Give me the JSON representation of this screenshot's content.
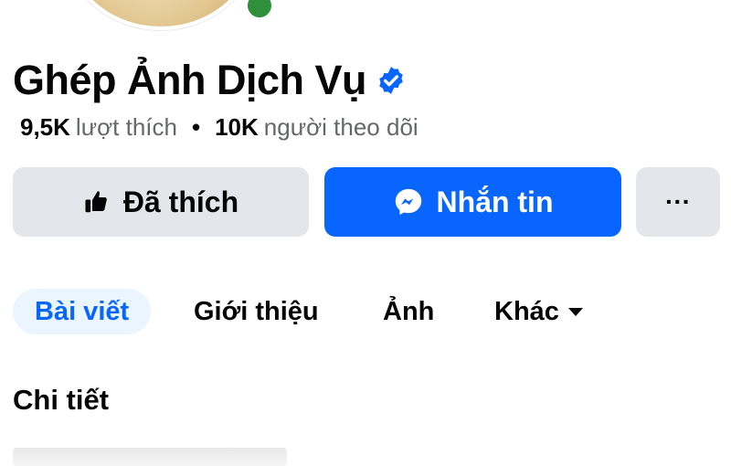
{
  "profile": {
    "name": "Ghép Ảnh Dịch Vụ",
    "verified": true
  },
  "stats": {
    "likes_count": "9,5K",
    "likes_label": "lượt thích",
    "separator": "•",
    "followers_count": "10K",
    "followers_label": "người theo dõi"
  },
  "actions": {
    "liked_label": "Đã thích",
    "message_label": "Nhắn tin",
    "more_label": "···"
  },
  "tabs": [
    {
      "label": "Bài viết",
      "active": true
    },
    {
      "label": "Giới thiệu",
      "active": false
    },
    {
      "label": "Ảnh",
      "active": false
    },
    {
      "label": "Khác",
      "active": false
    }
  ],
  "section": {
    "title": "Chi tiết"
  },
  "colors": {
    "accent": "#0866ff",
    "button_gray": "#e4e6eb",
    "active_tab_bg": "#ebf5ff",
    "secondary_text": "#65676b"
  },
  "icons": {
    "verified": "verified-badge-icon",
    "like": "thumbs-up-icon",
    "message": "messenger-icon",
    "more": "more-horizontal-icon",
    "dropdown": "caret-down-icon"
  }
}
